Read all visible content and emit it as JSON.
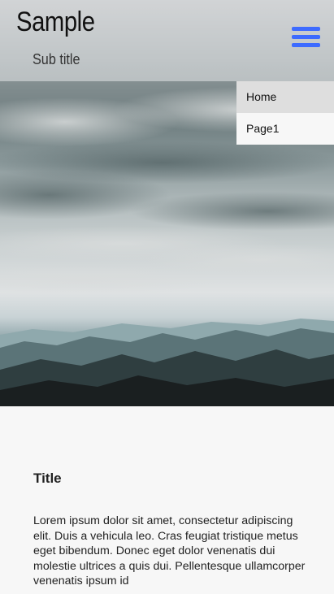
{
  "header": {
    "title": "Sample",
    "subtitle": "Sub title",
    "menu_icon": "hamburger-menu-icon",
    "menu_icon_color": "#3d6bff"
  },
  "nav": {
    "items": [
      {
        "label": "Home"
      },
      {
        "label": "Page1"
      }
    ]
  },
  "hero": {
    "image": "cloudy-sky-over-mountains"
  },
  "content": {
    "title": "Title",
    "body": "Lorem ipsum dolor sit amet, consectetur adipiscing elit. Duis a vehicula leo. Cras feugiat tristique metus eget bibendum. Donec eget dolor venenatis dui molestie ultrices a quis dui. Pellentesque ullamcorper venenatis ipsum id"
  }
}
